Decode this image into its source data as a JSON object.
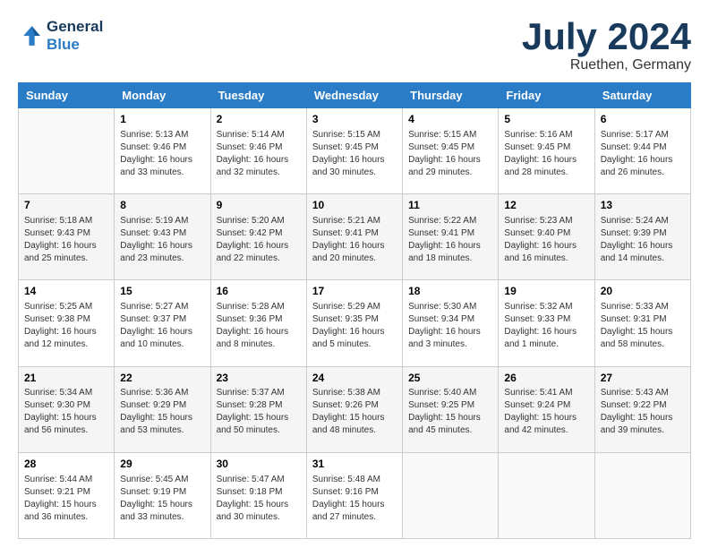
{
  "logo": {
    "line1": "General",
    "line2": "Blue"
  },
  "header": {
    "month_year": "July 2024",
    "location": "Ruethen, Germany"
  },
  "days_of_week": [
    "Sunday",
    "Monday",
    "Tuesday",
    "Wednesday",
    "Thursday",
    "Friday",
    "Saturday"
  ],
  "weeks": [
    [
      {
        "day": "",
        "info": ""
      },
      {
        "day": "1",
        "sunrise": "Sunrise: 5:13 AM",
        "sunset": "Sunset: 9:46 PM",
        "daylight": "Daylight: 16 hours and 33 minutes."
      },
      {
        "day": "2",
        "sunrise": "Sunrise: 5:14 AM",
        "sunset": "Sunset: 9:46 PM",
        "daylight": "Daylight: 16 hours and 32 minutes."
      },
      {
        "day": "3",
        "sunrise": "Sunrise: 5:15 AM",
        "sunset": "Sunset: 9:45 PM",
        "daylight": "Daylight: 16 hours and 30 minutes."
      },
      {
        "day": "4",
        "sunrise": "Sunrise: 5:15 AM",
        "sunset": "Sunset: 9:45 PM",
        "daylight": "Daylight: 16 hours and 29 minutes."
      },
      {
        "day": "5",
        "sunrise": "Sunrise: 5:16 AM",
        "sunset": "Sunset: 9:45 PM",
        "daylight": "Daylight: 16 hours and 28 minutes."
      },
      {
        "day": "6",
        "sunrise": "Sunrise: 5:17 AM",
        "sunset": "Sunset: 9:44 PM",
        "daylight": "Daylight: 16 hours and 26 minutes."
      }
    ],
    [
      {
        "day": "7",
        "sunrise": "Sunrise: 5:18 AM",
        "sunset": "Sunset: 9:43 PM",
        "daylight": "Daylight: 16 hours and 25 minutes."
      },
      {
        "day": "8",
        "sunrise": "Sunrise: 5:19 AM",
        "sunset": "Sunset: 9:43 PM",
        "daylight": "Daylight: 16 hours and 23 minutes."
      },
      {
        "day": "9",
        "sunrise": "Sunrise: 5:20 AM",
        "sunset": "Sunset: 9:42 PM",
        "daylight": "Daylight: 16 hours and 22 minutes."
      },
      {
        "day": "10",
        "sunrise": "Sunrise: 5:21 AM",
        "sunset": "Sunset: 9:41 PM",
        "daylight": "Daylight: 16 hours and 20 minutes."
      },
      {
        "day": "11",
        "sunrise": "Sunrise: 5:22 AM",
        "sunset": "Sunset: 9:41 PM",
        "daylight": "Daylight: 16 hours and 18 minutes."
      },
      {
        "day": "12",
        "sunrise": "Sunrise: 5:23 AM",
        "sunset": "Sunset: 9:40 PM",
        "daylight": "Daylight: 16 hours and 16 minutes."
      },
      {
        "day": "13",
        "sunrise": "Sunrise: 5:24 AM",
        "sunset": "Sunset: 9:39 PM",
        "daylight": "Daylight: 16 hours and 14 minutes."
      }
    ],
    [
      {
        "day": "14",
        "sunrise": "Sunrise: 5:25 AM",
        "sunset": "Sunset: 9:38 PM",
        "daylight": "Daylight: 16 hours and 12 minutes."
      },
      {
        "day": "15",
        "sunrise": "Sunrise: 5:27 AM",
        "sunset": "Sunset: 9:37 PM",
        "daylight": "Daylight: 16 hours and 10 minutes."
      },
      {
        "day": "16",
        "sunrise": "Sunrise: 5:28 AM",
        "sunset": "Sunset: 9:36 PM",
        "daylight": "Daylight: 16 hours and 8 minutes."
      },
      {
        "day": "17",
        "sunrise": "Sunrise: 5:29 AM",
        "sunset": "Sunset: 9:35 PM",
        "daylight": "Daylight: 16 hours and 5 minutes."
      },
      {
        "day": "18",
        "sunrise": "Sunrise: 5:30 AM",
        "sunset": "Sunset: 9:34 PM",
        "daylight": "Daylight: 16 hours and 3 minutes."
      },
      {
        "day": "19",
        "sunrise": "Sunrise: 5:32 AM",
        "sunset": "Sunset: 9:33 PM",
        "daylight": "Daylight: 16 hours and 1 minute."
      },
      {
        "day": "20",
        "sunrise": "Sunrise: 5:33 AM",
        "sunset": "Sunset: 9:31 PM",
        "daylight": "Daylight: 15 hours and 58 minutes."
      }
    ],
    [
      {
        "day": "21",
        "sunrise": "Sunrise: 5:34 AM",
        "sunset": "Sunset: 9:30 PM",
        "daylight": "Daylight: 15 hours and 56 minutes."
      },
      {
        "day": "22",
        "sunrise": "Sunrise: 5:36 AM",
        "sunset": "Sunset: 9:29 PM",
        "daylight": "Daylight: 15 hours and 53 minutes."
      },
      {
        "day": "23",
        "sunrise": "Sunrise: 5:37 AM",
        "sunset": "Sunset: 9:28 PM",
        "daylight": "Daylight: 15 hours and 50 minutes."
      },
      {
        "day": "24",
        "sunrise": "Sunrise: 5:38 AM",
        "sunset": "Sunset: 9:26 PM",
        "daylight": "Daylight: 15 hours and 48 minutes."
      },
      {
        "day": "25",
        "sunrise": "Sunrise: 5:40 AM",
        "sunset": "Sunset: 9:25 PM",
        "daylight": "Daylight: 15 hours and 45 minutes."
      },
      {
        "day": "26",
        "sunrise": "Sunrise: 5:41 AM",
        "sunset": "Sunset: 9:24 PM",
        "daylight": "Daylight: 15 hours and 42 minutes."
      },
      {
        "day": "27",
        "sunrise": "Sunrise: 5:43 AM",
        "sunset": "Sunset: 9:22 PM",
        "daylight": "Daylight: 15 hours and 39 minutes."
      }
    ],
    [
      {
        "day": "28",
        "sunrise": "Sunrise: 5:44 AM",
        "sunset": "Sunset: 9:21 PM",
        "daylight": "Daylight: 15 hours and 36 minutes."
      },
      {
        "day": "29",
        "sunrise": "Sunrise: 5:45 AM",
        "sunset": "Sunset: 9:19 PM",
        "daylight": "Daylight: 15 hours and 33 minutes."
      },
      {
        "day": "30",
        "sunrise": "Sunrise: 5:47 AM",
        "sunset": "Sunset: 9:18 PM",
        "daylight": "Daylight: 15 hours and 30 minutes."
      },
      {
        "day": "31",
        "sunrise": "Sunrise: 5:48 AM",
        "sunset": "Sunset: 9:16 PM",
        "daylight": "Daylight: 15 hours and 27 minutes."
      },
      {
        "day": "",
        "info": ""
      },
      {
        "day": "",
        "info": ""
      },
      {
        "day": "",
        "info": ""
      }
    ]
  ]
}
